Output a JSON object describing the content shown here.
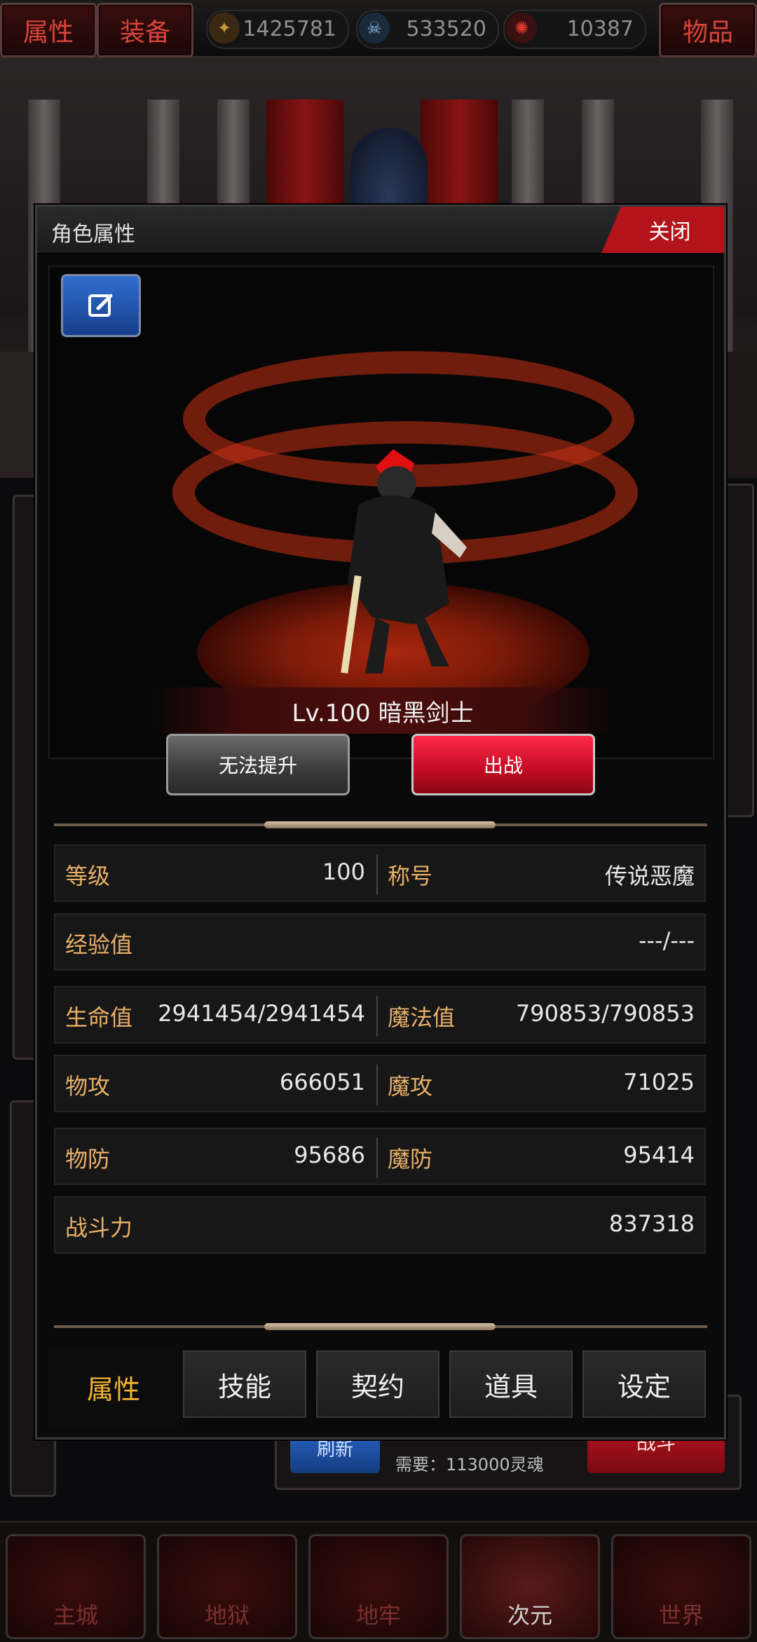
{
  "topbar": {
    "attributes_tab": "属性",
    "equipment_tab": "装备",
    "items_tab": "物品",
    "resources": [
      {
        "icon": "compass-coin-icon",
        "value": "1425781"
      },
      {
        "icon": "blue-skull-icon",
        "value": "533520"
      },
      {
        "icon": "red-swirl-icon",
        "value": "10387"
      }
    ]
  },
  "dialog": {
    "title": "角色属性",
    "close_label": "关闭",
    "character": {
      "name_line": "Lv.100 暗黑剑士"
    },
    "buttons": {
      "upgrade": "无法提升",
      "deploy": "出战"
    },
    "stats": {
      "level_label": "等级",
      "level_value": "100",
      "title_label": "称号",
      "title_value": "传说恶魔",
      "exp_label": "经验值",
      "exp_value": "---/---",
      "hp_label": "生命值",
      "hp_value": "2941454/2941454",
      "mp_label": "魔法值",
      "mp_value": "790853/790853",
      "patk_label": "物攻",
      "patk_value": "666051",
      "matk_label": "魔攻",
      "matk_value": "71025",
      "pdef_label": "物防",
      "pdef_value": "95686",
      "mdef_label": "魔防",
      "mdef_value": "95414",
      "power_label": "战斗力",
      "power_value": "837318"
    },
    "tabs": [
      "属性",
      "技能",
      "契约",
      "道具",
      "设定"
    ],
    "active_tab": "属性"
  },
  "background": {
    "refresh_label": "刷新",
    "cost_text": "需要：113000灵魂",
    "fight_label": "战斗"
  },
  "bottom_nav": [
    "主城",
    "地狱",
    "地牢",
    "次元",
    "世界"
  ],
  "colors": {
    "accent_red": "#b3141a",
    "stat_label": "#e8b068",
    "active_tab": "#f2b431"
  }
}
